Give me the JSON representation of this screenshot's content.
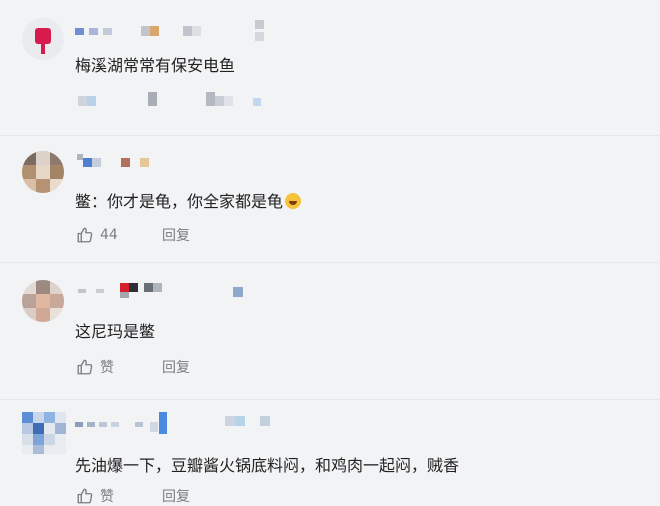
{
  "comments": [
    {
      "text": "梅溪湖常常有保安电鱼",
      "likes": "",
      "reply": ""
    },
    {
      "text": "鳖：你才是龟，你全家都是龟",
      "likes": "44",
      "reply": "回复"
    },
    {
      "text": "这尼玛是鳖",
      "likes": "赞",
      "reply": "回复"
    },
    {
      "text": "先油爆一下，豆瓣酱火锅底料闷，和鸡肉一起闷，贼香",
      "likes": "赞",
      "reply": "回复"
    }
  ],
  "colors": {
    "background": "#f2f3f5",
    "text": "#222222",
    "meta": "#7a7d83",
    "avatar1": "#d81b4f"
  },
  "icons": [
    "thumbs-up-icon",
    "laughing-emoji-icon"
  ]
}
